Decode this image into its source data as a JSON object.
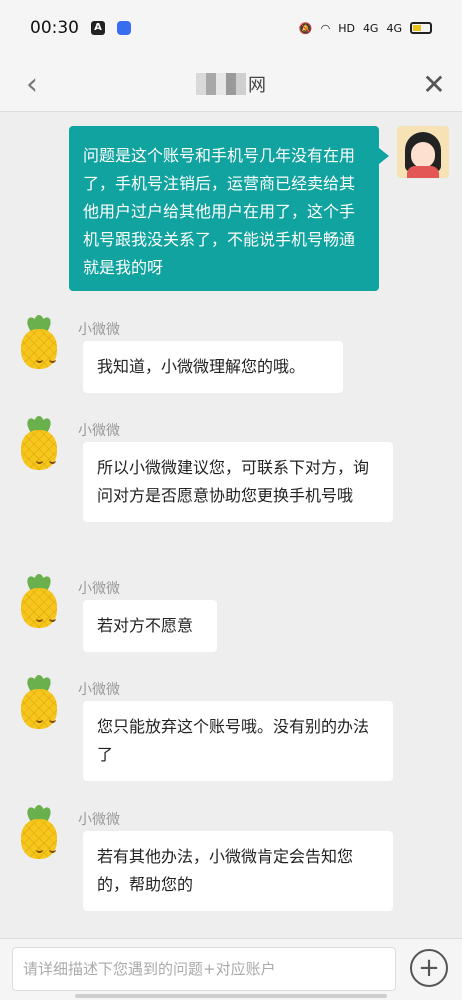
{
  "status_bar": {
    "time": "00:30",
    "right_text": "HD",
    "signal_1": "4G",
    "signal_2": "4G"
  },
  "nav": {
    "title_suffix": "网",
    "back_icon": "chevron-left-icon",
    "close_icon": "close-icon"
  },
  "chat": {
    "user_message": "问题是这个账号和手机号几年没有在用了，手机号注销后，运营商已经卖给其他用户过户给其他用户在用了，这个手机号跟我没关系了，不能说手机号畅通就是我的呀",
    "bot_name": "小微微",
    "bot_messages": [
      "我知道，小微微理解您的哦。",
      "所以小微微建议您，可联系下对方，询问对方是否愿意协助您更换手机号哦",
      "若对方不愿意",
      "您只能放弃这个账号哦。没有别的办法了",
      "若有其他办法，小微微肯定会告知您的，帮助您的"
    ]
  },
  "input_bar": {
    "placeholder": "请详细描述下您遇到的问题+对应账户",
    "add_icon": "plus-circle-icon"
  }
}
